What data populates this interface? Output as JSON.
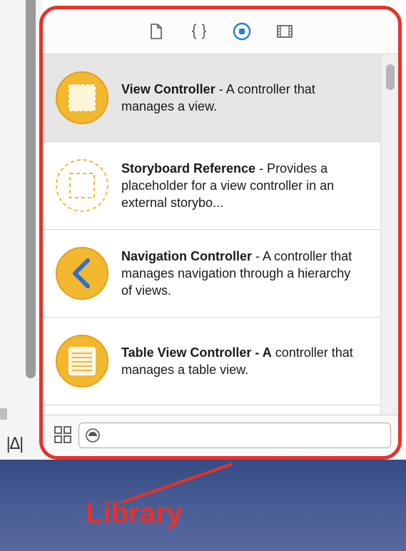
{
  "library": {
    "selector_tabs": [
      {
        "name": "file-template",
        "icon": "file-icon"
      },
      {
        "name": "code-snippet",
        "icon": "braces-icon"
      },
      {
        "name": "object",
        "icon": "object-icon",
        "active": true
      },
      {
        "name": "media",
        "icon": "film-icon"
      }
    ],
    "items": [
      {
        "title": "View Controller",
        "description": " - A controller that manages a view.",
        "icon": "view-controller-icon",
        "selected": true
      },
      {
        "title": "Storyboard Reference",
        "description": " - Provides a placeholder for a view controller in an external storybo...",
        "icon": "storyboard-reference-icon"
      },
      {
        "title": "Navigation Controller",
        "description": " - A controller that manages navigation through a hierarchy of views.",
        "icon": "navigation-controller-icon"
      },
      {
        "title": "Table View Controller - A",
        "description": " controller that manages a table view.",
        "icon": "table-view-controller-icon"
      }
    ],
    "filter": {
      "value": "",
      "placeholder": ""
    }
  },
  "callout": {
    "label": "Library"
  },
  "colors": {
    "accent": "#e5322a",
    "icon_fill": "#f2b830",
    "icon_stroke": "#e3a01a",
    "blue": "#1f7fe0"
  }
}
